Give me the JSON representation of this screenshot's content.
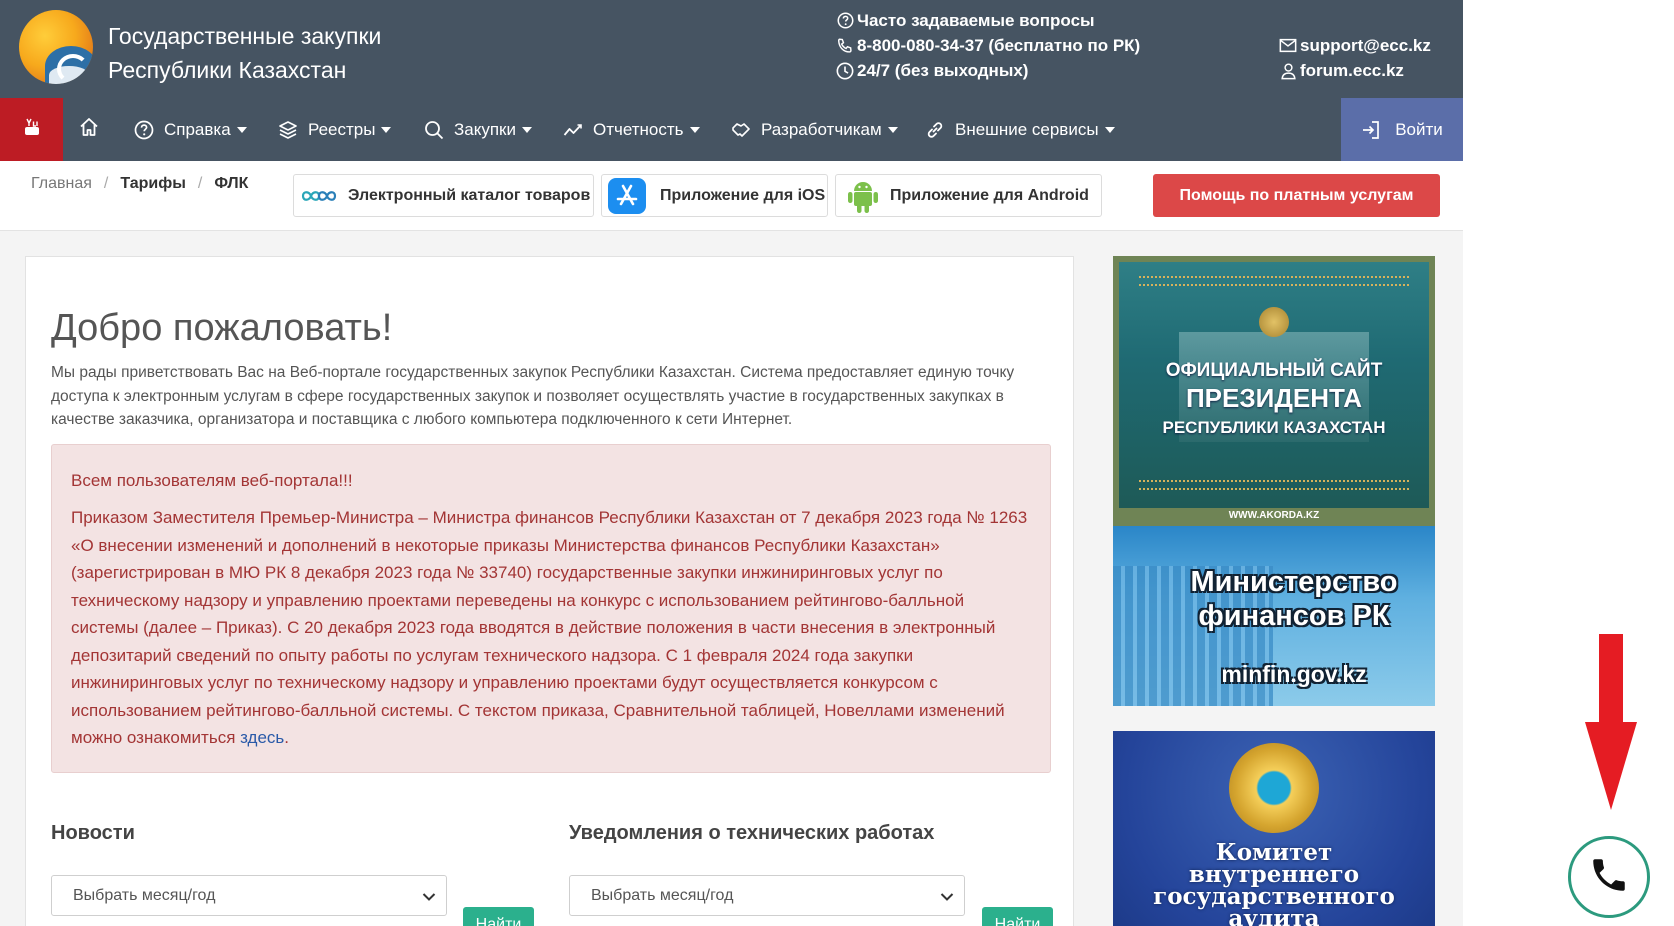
{
  "header": {
    "title_line1": "Государственные закупки",
    "title_line2": "Республики Казахстан",
    "faq": "Часто задаваемые вопросы",
    "phone": "8-800-080-34-37 (бесплатно по РК)",
    "hours": "24/7 (без выходных)",
    "email": "support@ecc.kz",
    "forum": "forum.ecc.kz"
  },
  "nav": {
    "items": [
      {
        "label": "Справка",
        "icon": "question-circle-icon"
      },
      {
        "label": "Реестры",
        "icon": "layers-icon"
      },
      {
        "label": "Закупки",
        "icon": "search-icon"
      },
      {
        "label": "Отчетность",
        "icon": "chart-line-icon"
      },
      {
        "label": "Разработчикам",
        "icon": "handshake-icon"
      },
      {
        "label": "Внешние сервисы",
        "icon": "link-icon"
      }
    ],
    "login": "Войти"
  },
  "breadcrumb": [
    "Главная",
    "Тарифы",
    "ФЛК"
  ],
  "quicklinks": {
    "catalog": "Электронный каталог товаров",
    "ios": "Приложение для iOS",
    "android": "Приложение для Android",
    "help": "Помощь по платным услугам"
  },
  "main": {
    "welcome": "Добро пожаловать!",
    "intro": "Мы рады приветствовать Вас на Веб-портале государственных закупок Республики Казахстан. Система предоставляет единую точку доступа к электронным услугам в сфере государственных закупок и позволяет осуществлять участие в государственных закупках в качестве заказчика, организатора и поставщика с любого компьютера подключенного к сети Интернет.",
    "alert_title": "Всем пользователям веб-портала!!!",
    "alert_text": "Приказом Заместителя Премьер-Министра – Министра финансов Республики Казахстан от 7 декабря 2023 года № 1263 «О внесении изменений и дополнений в некоторые приказы Министерства финансов Республики Казахстан» (зарегистрирован в МЮ РК 8 декабря 2023 года № 33740) государственные закупки инжиниринговых услуг по техническому надзору и управлению проектами переведены на конкурс с использованием рейтингово-балльной системы (далее – Приказ). С 20 декабря 2023 года вводятся в действие положения в части внесения в электронный депозитарий сведений по опыту работы по услугам технического надзора. С 1 февраля 2024 года закупки инжиниринговых услуг по техническому надзору и управлению проектами будут осуществляется конкурсом с использованием рейтингово-балльной системы. С текстом приказа, Сравнительной таблицей, Новеллами изменений можно ознакомиться ",
    "alert_link": "здесь",
    "alert_end": ".",
    "news_title": "Новости",
    "tech_title": "Уведомления о технических работах",
    "select_placeholder": "Выбрать месяц/год",
    "find_button": "Найти"
  },
  "banners": {
    "b1_line1": "ОФИЦИАЛЬНЫЙ САЙТ",
    "b1_line2": "ПРЕЗИДЕНТА",
    "b1_line3": "РЕСПУБЛИКИ КАЗАХСТАН",
    "b1_url": "WWW.AKORDA.KZ",
    "b2_line1": "Министерство",
    "b2_line2": "финансов РК",
    "b2_url": "minfin.gov.kz",
    "b3_line1": "Комитет",
    "b3_line2": "внутреннего",
    "b3_line3": "государственного",
    "b3_line4": "аудита"
  },
  "colors": {
    "header_bg": "#465462",
    "youtube_red": "#bd1c24",
    "login_bg": "#5b6ea9",
    "help_red": "#dc4848",
    "alert_bg": "#f3e3e3",
    "alert_text": "#a33535",
    "find_green": "#2bb08d",
    "arrow_red": "#e51c23"
  }
}
